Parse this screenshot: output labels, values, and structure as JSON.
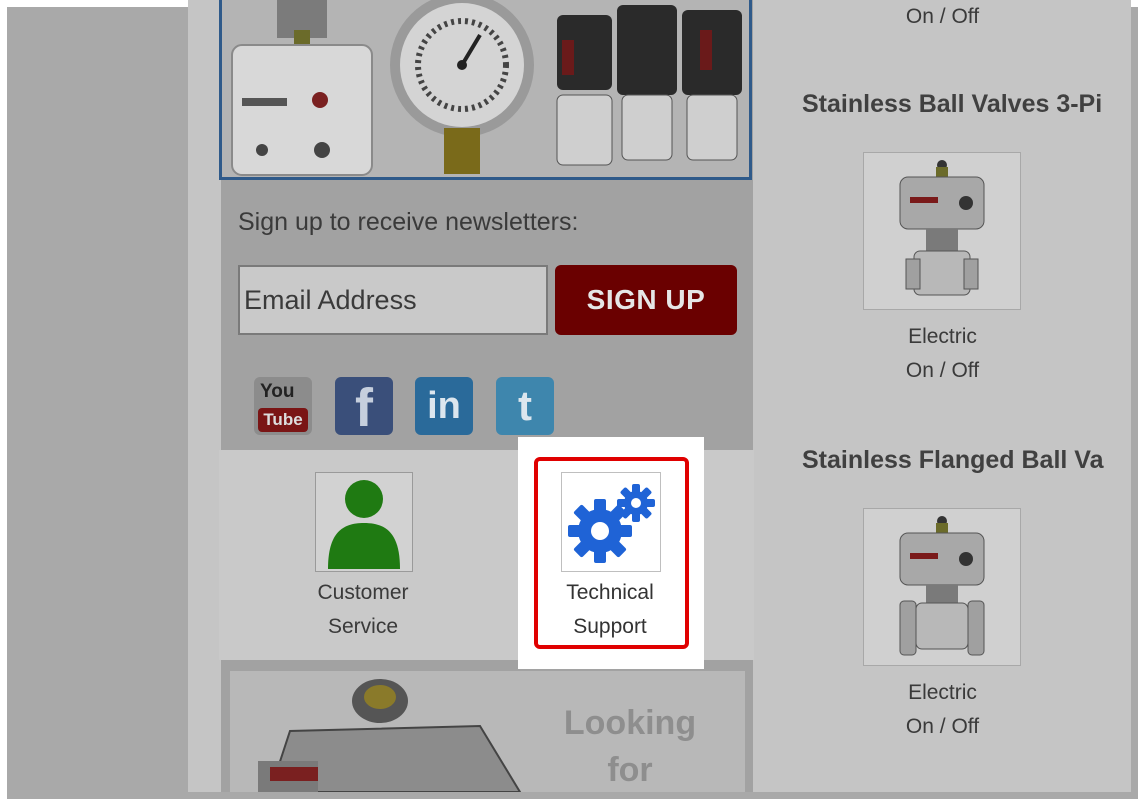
{
  "newsletter": {
    "label": "Sign up to receive newsletters:",
    "email_placeholder": "Email Address",
    "signup_label": "SIGN UP"
  },
  "social": {
    "youtube_top": "You",
    "youtube_bottom": "Tube",
    "facebook": "f",
    "linkedin": "in",
    "twitter": "t"
  },
  "support": {
    "customer_service": {
      "line1": "Customer",
      "line2": "Service"
    },
    "technical_support": {
      "line1": "Technical",
      "line2": "Support"
    }
  },
  "ad": {
    "line1": "Looking",
    "line2": "for"
  },
  "products": {
    "top_caption": "On / Off",
    "items": [
      {
        "title": "Stainless Ball Valves 3-Pi",
        "caption1": "Electric",
        "caption2": "On / Off"
      },
      {
        "title": "Stainless Flanged Ball Va",
        "caption1": "Electric",
        "caption2": "On / Off"
      }
    ]
  },
  "colors": {
    "signup_button": "#6a0000",
    "highlight_border": "#e00000",
    "gear_icon": "#1f63d6",
    "customer_icon": "#1f7a12"
  }
}
